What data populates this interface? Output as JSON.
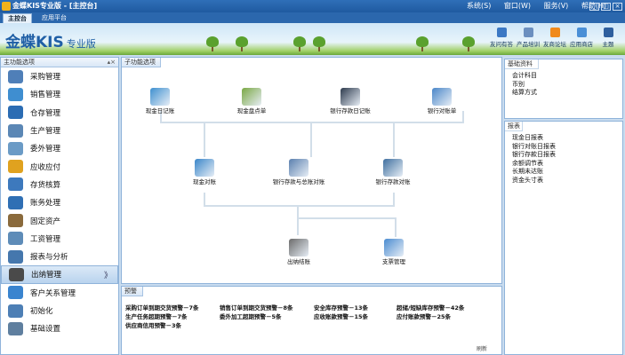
{
  "window": {
    "title": "金蝶KIS专业版 - [主控台]",
    "menus": [
      "系统(S)",
      "窗口(W)",
      "服务(V)",
      "帮助(H)"
    ],
    "buttons": [
      "_",
      "□",
      "×"
    ]
  },
  "tabs": [
    "主控台",
    "应用平台"
  ],
  "brand": {
    "name": "金蝶KIS",
    "edition": "专业版"
  },
  "shortcuts": [
    {
      "label": "友问有答",
      "icon": "qa-icon",
      "color": "#3b78c4"
    },
    {
      "label": "产品培训",
      "icon": "training-icon",
      "color": "#6b8fbf"
    },
    {
      "label": "友商论坛",
      "icon": "forum-icon",
      "color": "#f08a1c"
    },
    {
      "label": "应用商店",
      "icon": "store-icon",
      "color": "#4a8fd6"
    },
    {
      "label": "主题",
      "icon": "theme-icon",
      "color": "#2e5f9e"
    }
  ],
  "left_panel": {
    "header": "主功能选项",
    "pin": "▴×",
    "items": [
      {
        "label": "采购管理",
        "icon": "purchase-icon",
        "color": "#4f7fb8"
      },
      {
        "label": "销售管理",
        "icon": "sales-icon",
        "color": "#3f8ed0"
      },
      {
        "label": "仓存管理",
        "icon": "warehouse-icon",
        "color": "#2b6cb3"
      },
      {
        "label": "生产管理",
        "icon": "production-icon",
        "color": "#5b87b5"
      },
      {
        "label": "委外管理",
        "icon": "outsource-icon",
        "color": "#6b9bc6"
      },
      {
        "label": "应收应付",
        "icon": "receivable-icon",
        "color": "#e0a21f"
      },
      {
        "label": "存货核算",
        "icon": "inventory-icon",
        "color": "#3d79bd"
      },
      {
        "label": "账务处理",
        "icon": "accounting-icon",
        "color": "#2f6fb4"
      },
      {
        "label": "固定资产",
        "icon": "asset-icon",
        "color": "#8a6a3c"
      },
      {
        "label": "工资管理",
        "icon": "salary-icon",
        "color": "#5e8cb8"
      },
      {
        "label": "报表与分析",
        "icon": "report-icon",
        "color": "#4577ad"
      },
      {
        "label": "出纳管理",
        "icon": "cashier-icon",
        "color": "#4a4a4a"
      },
      {
        "label": "客户关系管理",
        "icon": "crm-icon",
        "color": "#3a84cf"
      },
      {
        "label": "初始化",
        "icon": "init-icon",
        "color": "#4d7fb5"
      },
      {
        "label": "基础设置",
        "icon": "settings-icon",
        "color": "#5f7f9f"
      }
    ],
    "active_index": 11,
    "active_arrow": "》"
  },
  "center": {
    "header": "子功能选项",
    "nodes": [
      {
        "label": "现金日记账",
        "icon": "cash-journal-icon",
        "color": "#3e8fcf"
      },
      {
        "label": "现金盘点单",
        "icon": "cash-count-icon",
        "color": "#7aa844"
      },
      {
        "label": "银行存款日记账",
        "icon": "bank-journal-icon",
        "color": "#2d3a4d"
      },
      {
        "label": "银行对账单",
        "icon": "bank-statement-icon",
        "color": "#4a86c8"
      },
      {
        "label": "现金对账",
        "icon": "cash-reconcile-icon",
        "color": "#3a86c9"
      },
      {
        "label": "银行存款与总账对账",
        "icon": "bank-ledger-reconcile-icon",
        "color": "#5a7fae"
      },
      {
        "label": "银行存款对账",
        "icon": "bank-reconcile-icon",
        "color": "#3f6f9f"
      },
      {
        "label": "出纳结账",
        "icon": "cashier-close-icon",
        "color": "#6b6b6b"
      },
      {
        "label": "支票管理",
        "icon": "check-icon",
        "color": "#4a8bd0"
      }
    ]
  },
  "warnings": {
    "header": "预警",
    "items": [
      "采购订单到期交货预警－7条",
      "销售订单到期交货预警－8条",
      "安全库存预警－13条",
      "超储/短缺库存预警－42条",
      "生产任务超期预警－7条",
      "委外加工超期预警－5条",
      "应收账款预警－15条",
      "应付账款预警－25条",
      "供应商信用预警－3条"
    ],
    "corner": "刷新"
  },
  "right_panel": {
    "sections": [
      {
        "header": "基础资料",
        "links": [
          "会计科目",
          "币别",
          "结算方式"
        ]
      },
      {
        "header": "报表",
        "links": [
          "现金日报表",
          "银行对账日报表",
          "银行存款日报表",
          "余额调节表",
          "长期未达账",
          "资金头寸表"
        ]
      }
    ]
  }
}
